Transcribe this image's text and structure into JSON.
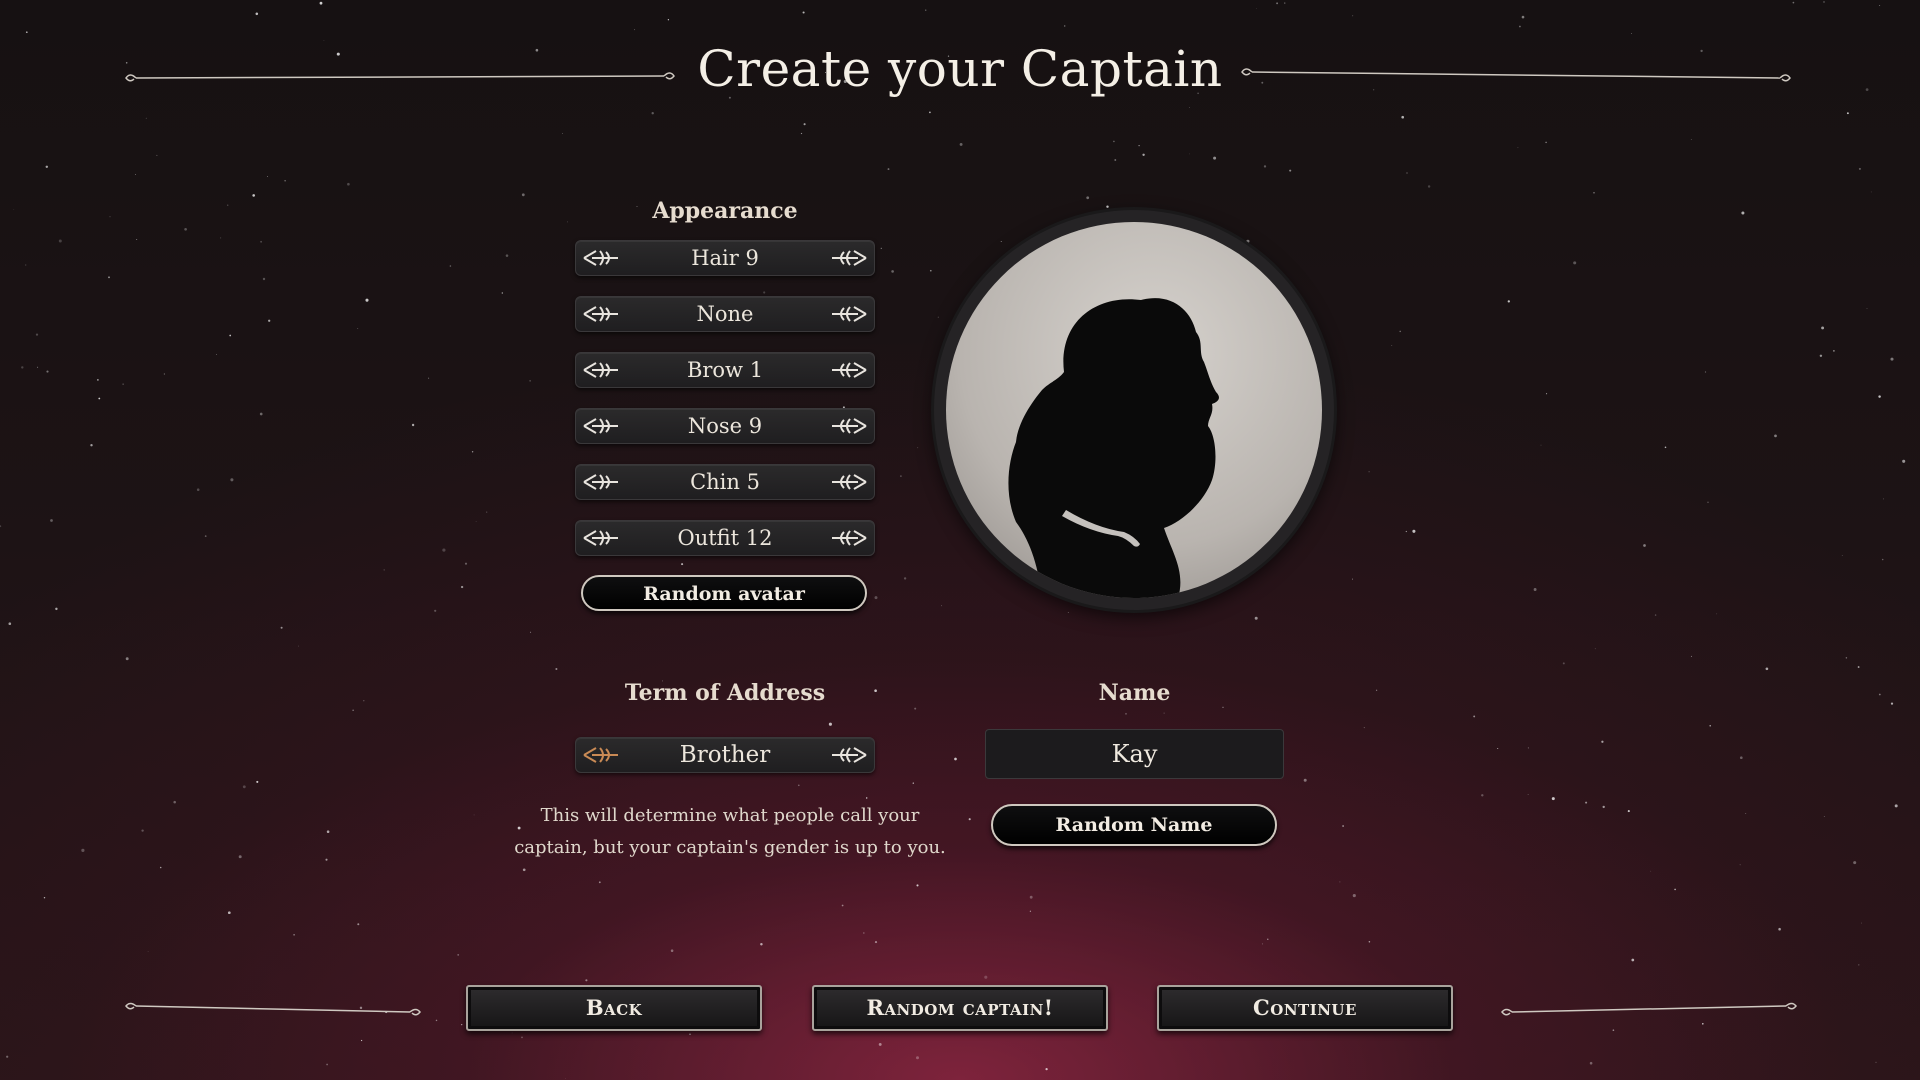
{
  "title": "Create your Captain",
  "appearance": {
    "label": "Appearance",
    "options": [
      "Hair 9",
      "None",
      "Brow 1",
      "Nose 9",
      "Chin 5",
      "Outfit 12"
    ],
    "random_avatar_label": "Random avatar"
  },
  "term_of_address": {
    "label": "Term of Address",
    "value": "Brother",
    "hint_line1": "This will determine what people call your",
    "hint_line2": "captain, but your captain's gender is up to you."
  },
  "name": {
    "label": "Name",
    "value": "Kay",
    "random_name_label": "Random Name"
  },
  "footer": {
    "back_label": "Back",
    "random_captain_label": "Random captain!",
    "continue_label": "Continue"
  },
  "colors": {
    "accent_arrow_active": "#c98a55",
    "arrow_default": "#e8e4de"
  },
  "icons": {
    "arrow_left": "ornate-left-arrow-icon",
    "arrow_right": "ornate-right-arrow-icon"
  }
}
